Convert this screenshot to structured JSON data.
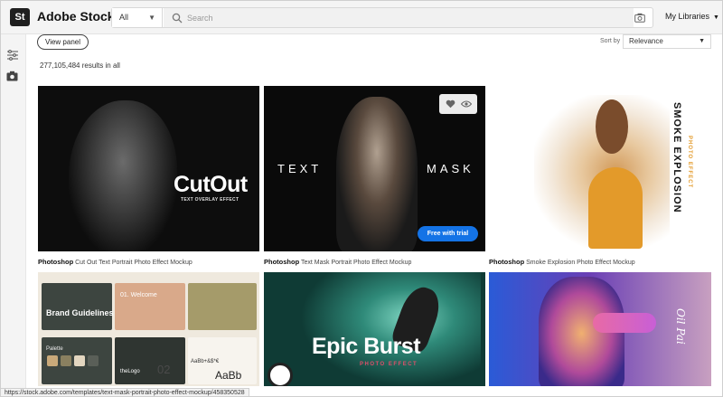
{
  "header": {
    "logo_glyph": "St",
    "app_name": "Adobe Stock",
    "search_filter": "All",
    "search_placeholder": "Search",
    "libraries_label": "My Libraries"
  },
  "controls": {
    "view_panel_label": "View panel",
    "sort_label": "Sort by",
    "sort_value": "Relevance",
    "results_text": "277,105,484 results in all"
  },
  "cards": [
    {
      "category": "Photoshop",
      "title": "Cut Out Text Portrait Photo Effect Mockup",
      "art_title": "CutOut",
      "art_subtitle": "TEXT OVERLAY EFFECT"
    },
    {
      "category": "Photoshop",
      "title": "Text Mask Portrait Photo Effect Mockup",
      "art_left": "TEXT",
      "art_right": "MASK",
      "trial_label": "Free with trial"
    },
    {
      "category": "Photoshop",
      "title": "Smoke Explosion Photo Effect Mockup",
      "art_title": "SMOKE EXPLOSION",
      "art_subtitle": "PHOTO EFFECT"
    },
    {
      "art_brand": "Brand Guidelines",
      "art_welcome": "01. Welcome",
      "art_palette": "Palette",
      "art_logo": "theLogo",
      "art_num": "02",
      "art_type_small": "AaBb+&$*€",
      "art_type_big": "AaBb"
    },
    {
      "art_title": "Epic Burst",
      "art_subtitle": "PHOTO EFFECT"
    },
    {
      "art_script": "Oil Pai"
    }
  ],
  "status_url": "https://stock.adobe.com/templates/text-mask-portrait-photo-effect-mockup/458350528",
  "colors": {
    "accent": "#1473e6",
    "topbar": "#f4f4f4"
  },
  "icons": [
    "filter-icon",
    "camera-icon",
    "search-icon",
    "heart-icon",
    "eye-icon",
    "chevron-down-icon"
  ]
}
